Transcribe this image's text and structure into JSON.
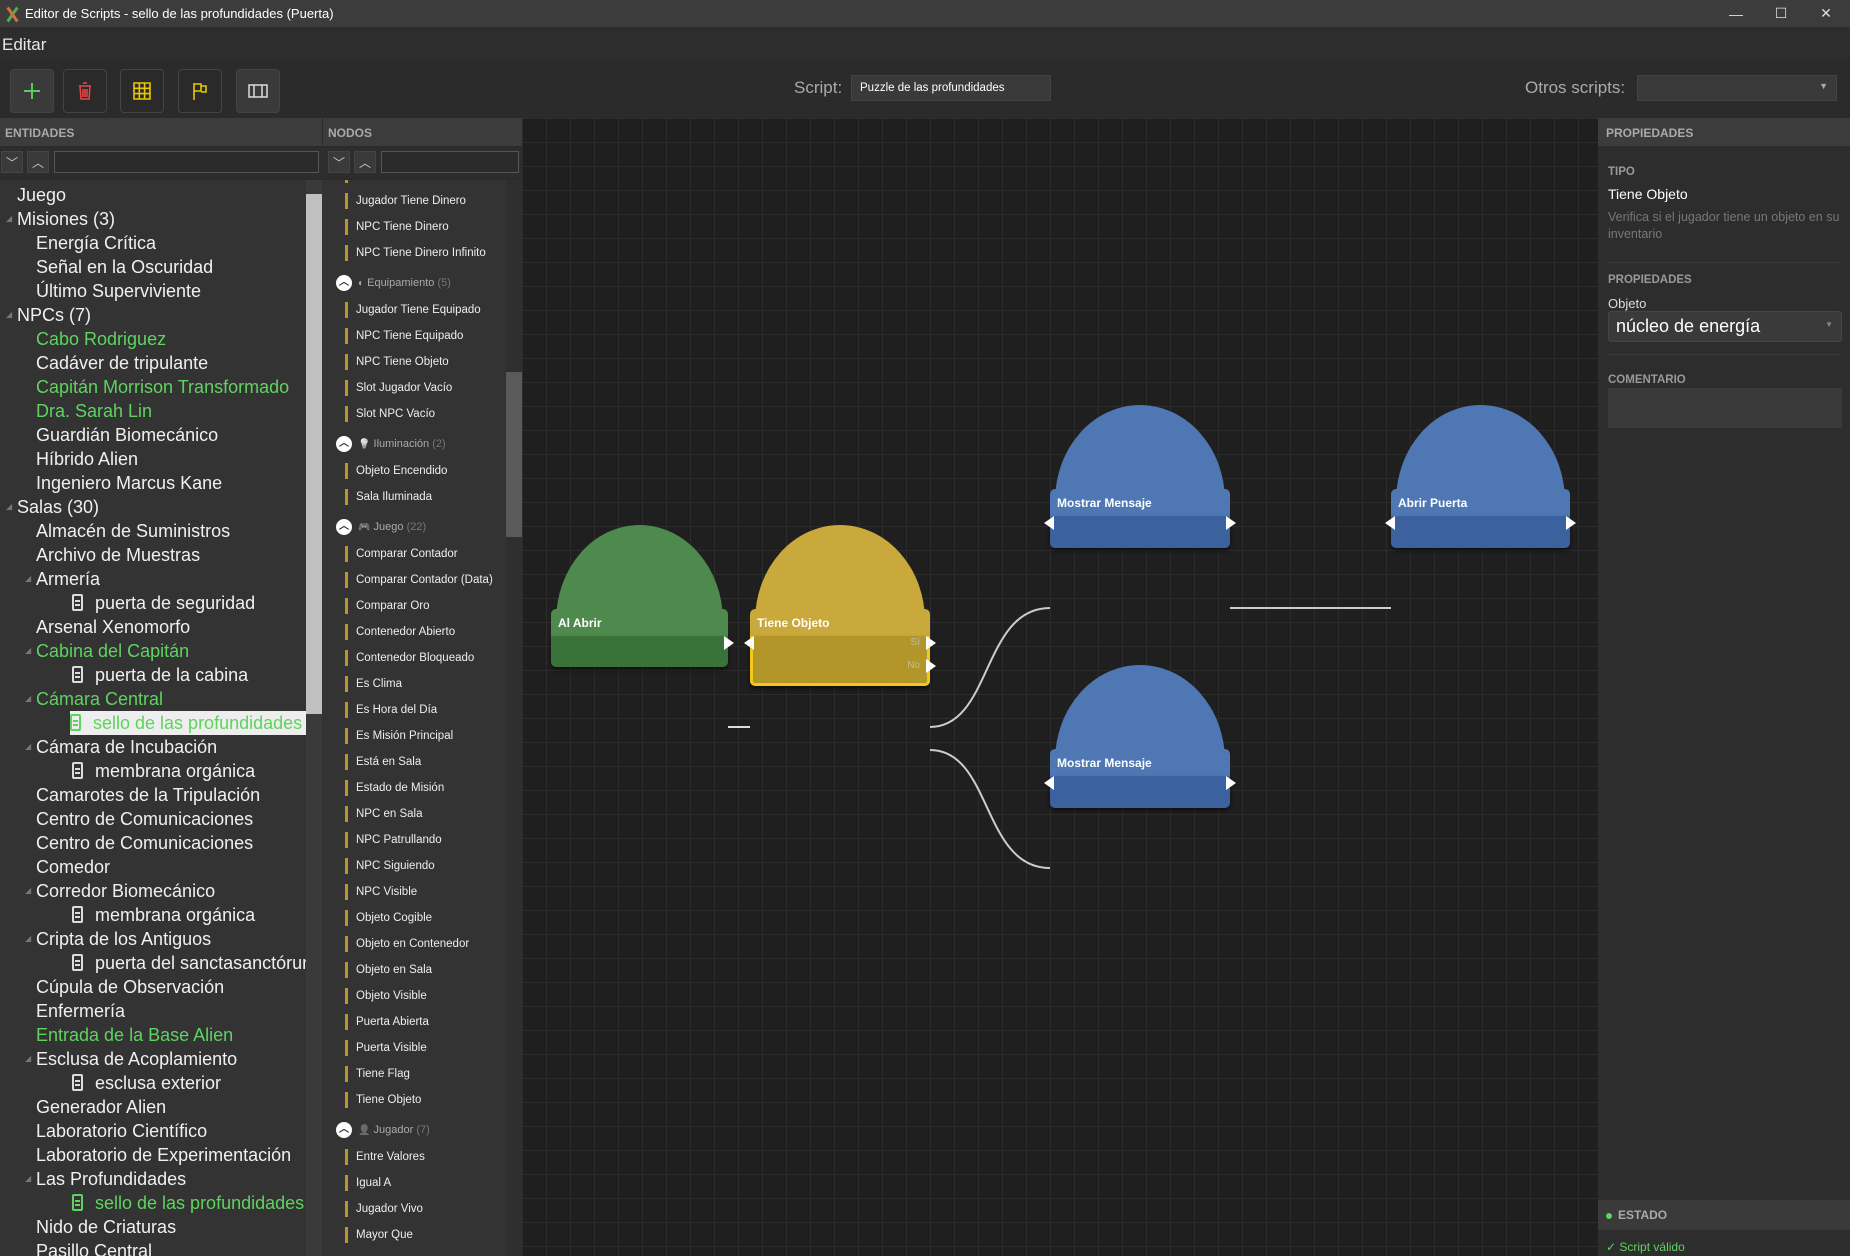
{
  "window": {
    "title": "Editor de Scripts - sello de las profundidades (Puerta)",
    "minimize": "—",
    "maximize": "☐",
    "close": "✕"
  },
  "menu": {
    "edit": "Editar"
  },
  "toolbar": {
    "buttons": [
      {
        "icon": "plus-icon",
        "color": "#5cc95c"
      },
      {
        "icon": "trash-icon",
        "color": "#e84848"
      },
      {
        "icon": "grid-icon",
        "color": "#e8c800"
      },
      {
        "icon": "flag-icon",
        "color": "#e8c800"
      },
      {
        "icon": "panel-icon",
        "color": "#dddddd"
      }
    ],
    "script_label": "Script:",
    "script_value": "Puzzle de las profundidades",
    "other_scripts_label": "Otros scripts:",
    "other_scripts_value": ""
  },
  "entities": {
    "header": "ENTIDADES",
    "filter_placeholder": "",
    "items": [
      {
        "label": "Juego",
        "level": 0
      },
      {
        "label": "Misiones (3)",
        "level": 0,
        "expander": true
      },
      {
        "label": "Energía Crítica",
        "level": 1
      },
      {
        "label": "Señal en la Oscuridad",
        "level": 1
      },
      {
        "label": "Último Superviviente",
        "level": 1
      },
      {
        "label": "NPCs (7)",
        "level": 0,
        "expander": true
      },
      {
        "label": "Cabo Rodriguez",
        "level": 1,
        "green": true
      },
      {
        "label": "Cadáver de tripulante",
        "level": 1
      },
      {
        "label": "Capitán Morrison Transformado",
        "level": 1,
        "green": true
      },
      {
        "label": "Dra. Sarah Lin",
        "level": 1,
        "green": true
      },
      {
        "label": "Guardián Biomecánico",
        "level": 1
      },
      {
        "label": "Híbrido Alien",
        "level": 1
      },
      {
        "label": "Ingeniero Marcus Kane",
        "level": 1
      },
      {
        "label": "Salas (30)",
        "level": 0,
        "expander": true
      },
      {
        "label": "Almacén de Suministros",
        "level": 1
      },
      {
        "label": "Archivo de Muestras",
        "level": 1
      },
      {
        "label": "Armería",
        "level": 1,
        "expander": true
      },
      {
        "label": "puerta de seguridad",
        "level": 2,
        "door": true
      },
      {
        "label": "Arsenal Xenomorfo",
        "level": 1
      },
      {
        "label": "Cabina del Capitán",
        "level": 1,
        "expander": true,
        "green": true
      },
      {
        "label": "puerta de la cabina",
        "level": 2,
        "door": true
      },
      {
        "label": "Cámara Central",
        "level": 1,
        "expander": true,
        "green": true
      },
      {
        "label": "sello de las profundidades",
        "level": 2,
        "door": true,
        "green": true,
        "selected": true
      },
      {
        "label": "Cámara de Incubación",
        "level": 1,
        "expander": true
      },
      {
        "label": "membrana orgánica",
        "level": 2,
        "door": true
      },
      {
        "label": "Camarotes de la Tripulación",
        "level": 1
      },
      {
        "label": "Centro de Comunicaciones",
        "level": 1
      },
      {
        "label": "Centro de Comunicaciones",
        "level": 1
      },
      {
        "label": "Comedor",
        "level": 1
      },
      {
        "label": "Corredor Biomecánico",
        "level": 1,
        "expander": true
      },
      {
        "label": "membrana orgánica",
        "level": 2,
        "door": true
      },
      {
        "label": "Cripta de los Antiguos",
        "level": 1,
        "expander": true
      },
      {
        "label": "puerta del sanctasanctórum",
        "level": 2,
        "door": true
      },
      {
        "label": "Cúpula de Observación",
        "level": 1
      },
      {
        "label": "Enfermería",
        "level": 1
      },
      {
        "label": "Entrada de la Base Alien",
        "level": 1,
        "green": true
      },
      {
        "label": "Esclusa de Acoplamiento",
        "level": 1,
        "expander": true
      },
      {
        "label": "esclusa exterior",
        "level": 2,
        "door": true
      },
      {
        "label": "Generador Alien",
        "level": 1
      },
      {
        "label": "Laboratorio Científico",
        "level": 1
      },
      {
        "label": "Laboratorio de Experimentación",
        "level": 1
      },
      {
        "label": "Las Profundidades",
        "level": 1,
        "expander": true
      },
      {
        "label": "sello de las profundidades",
        "level": 2,
        "door": true,
        "green": true
      },
      {
        "label": "Nido de Criaturas",
        "level": 1
      },
      {
        "label": "Pasillo Central",
        "level": 1
      }
    ]
  },
  "nodes_panel": {
    "header": "NODOS",
    "filter_placeholder": "",
    "items": [
      {
        "type": "item",
        "label": ""
      },
      {
        "type": "item",
        "label": "Jugador Tiene Dinero"
      },
      {
        "type": "item",
        "label": "NPC Tiene Dinero"
      },
      {
        "type": "item",
        "label": "NPC Tiene Dinero Infinito"
      },
      {
        "type": "category",
        "label": "Equipamiento",
        "count": "(5)",
        "icon": "◐"
      },
      {
        "type": "item",
        "label": "Jugador Tiene Equipado"
      },
      {
        "type": "item",
        "label": "NPC Tiene Equipado"
      },
      {
        "type": "item",
        "label": "NPC Tiene Objeto"
      },
      {
        "type": "item",
        "label": "Slot Jugador Vacío"
      },
      {
        "type": "item",
        "label": "Slot NPC Vacío"
      },
      {
        "type": "category",
        "label": "Iluminación",
        "count": "(2)",
        "icon": "💡"
      },
      {
        "type": "item",
        "label": "Objeto Encendido"
      },
      {
        "type": "item",
        "label": "Sala Iluminada"
      },
      {
        "type": "category",
        "label": "Juego",
        "count": "(22)",
        "icon": "🎮"
      },
      {
        "type": "item",
        "label": "Comparar Contador"
      },
      {
        "type": "item",
        "label": "Comparar Contador (Data)"
      },
      {
        "type": "item",
        "label": "Comparar Oro"
      },
      {
        "type": "item",
        "label": "Contenedor Abierto"
      },
      {
        "type": "item",
        "label": "Contenedor Bloqueado"
      },
      {
        "type": "item",
        "label": "Es Clima"
      },
      {
        "type": "item",
        "label": "Es Hora del Día"
      },
      {
        "type": "item",
        "label": "Es Misión Principal"
      },
      {
        "type": "item",
        "label": "Está en Sala"
      },
      {
        "type": "item",
        "label": "Estado de Misión"
      },
      {
        "type": "item",
        "label": "NPC en Sala"
      },
      {
        "type": "item",
        "label": "NPC Patrullando"
      },
      {
        "type": "item",
        "label": "NPC Siguiendo"
      },
      {
        "type": "item",
        "label": "NPC Visible"
      },
      {
        "type": "item",
        "label": "Objeto Cogible"
      },
      {
        "type": "item",
        "label": "Objeto en Contenedor"
      },
      {
        "type": "item",
        "label": "Objeto en Sala"
      },
      {
        "type": "item",
        "label": "Objeto Visible"
      },
      {
        "type": "item",
        "label": "Puerta Abierta"
      },
      {
        "type": "item",
        "label": "Puerta Visible"
      },
      {
        "type": "item",
        "label": "Tiene Flag"
      },
      {
        "type": "item",
        "label": "Tiene Objeto"
      },
      {
        "type": "category",
        "label": "Jugador",
        "count": "(7)",
        "icon": "👤"
      },
      {
        "type": "item",
        "label": "Entre Valores"
      },
      {
        "type": "item",
        "label": "Igual A"
      },
      {
        "type": "item",
        "label": "Jugador Vivo"
      },
      {
        "type": "item",
        "label": "Mayor Que"
      }
    ]
  },
  "graph": {
    "nodes": [
      {
        "id": "al-abrir",
        "title": "Al Abrir",
        "kind": "event",
        "color": "#4e8a4e",
        "body": "#3a733a"
      },
      {
        "id": "tiene-objeto",
        "title": "Tiene Objeto",
        "kind": "condition",
        "color": "#c9a83c",
        "body": "#b3962a",
        "selected": true,
        "outputs": [
          "Sí",
          "No"
        ]
      },
      {
        "id": "mostrar-mensaje-1",
        "title": "Mostrar Mensaje",
        "kind": "action",
        "color": "#4f77b3",
        "body": "#3b629e"
      },
      {
        "id": "abrir-puerta",
        "title": "Abrir Puerta",
        "kind": "action",
        "color": "#4f77b3",
        "body": "#3b629e"
      },
      {
        "id": "mostrar-mensaje-2",
        "title": "Mostrar Mensaje",
        "kind": "action",
        "color": "#4f77b3",
        "body": "#3b629e"
      }
    ],
    "connections": [
      [
        "al-abrir",
        "tiene-objeto"
      ],
      [
        "tiene-objeto:Sí",
        "mostrar-mensaje-1"
      ],
      [
        "tiene-objeto:No",
        "mostrar-mensaje-2"
      ],
      [
        "mostrar-mensaje-1",
        "abrir-puerta"
      ]
    ]
  },
  "properties": {
    "header": "PROPIEDADES",
    "type_label": "TIPO",
    "type_value": "Tiene Objeto",
    "description": "Verifica si el jugador tiene un objeto en su inventario",
    "props_label": "PROPIEDADES",
    "object_label": "Objeto",
    "object_value": "núcleo de energía",
    "comment_label": "COMENTARIO",
    "comment_value": "",
    "status_label": "ESTADO",
    "status_value": "✓ Script válido",
    "status_color": "#5fd35f"
  }
}
